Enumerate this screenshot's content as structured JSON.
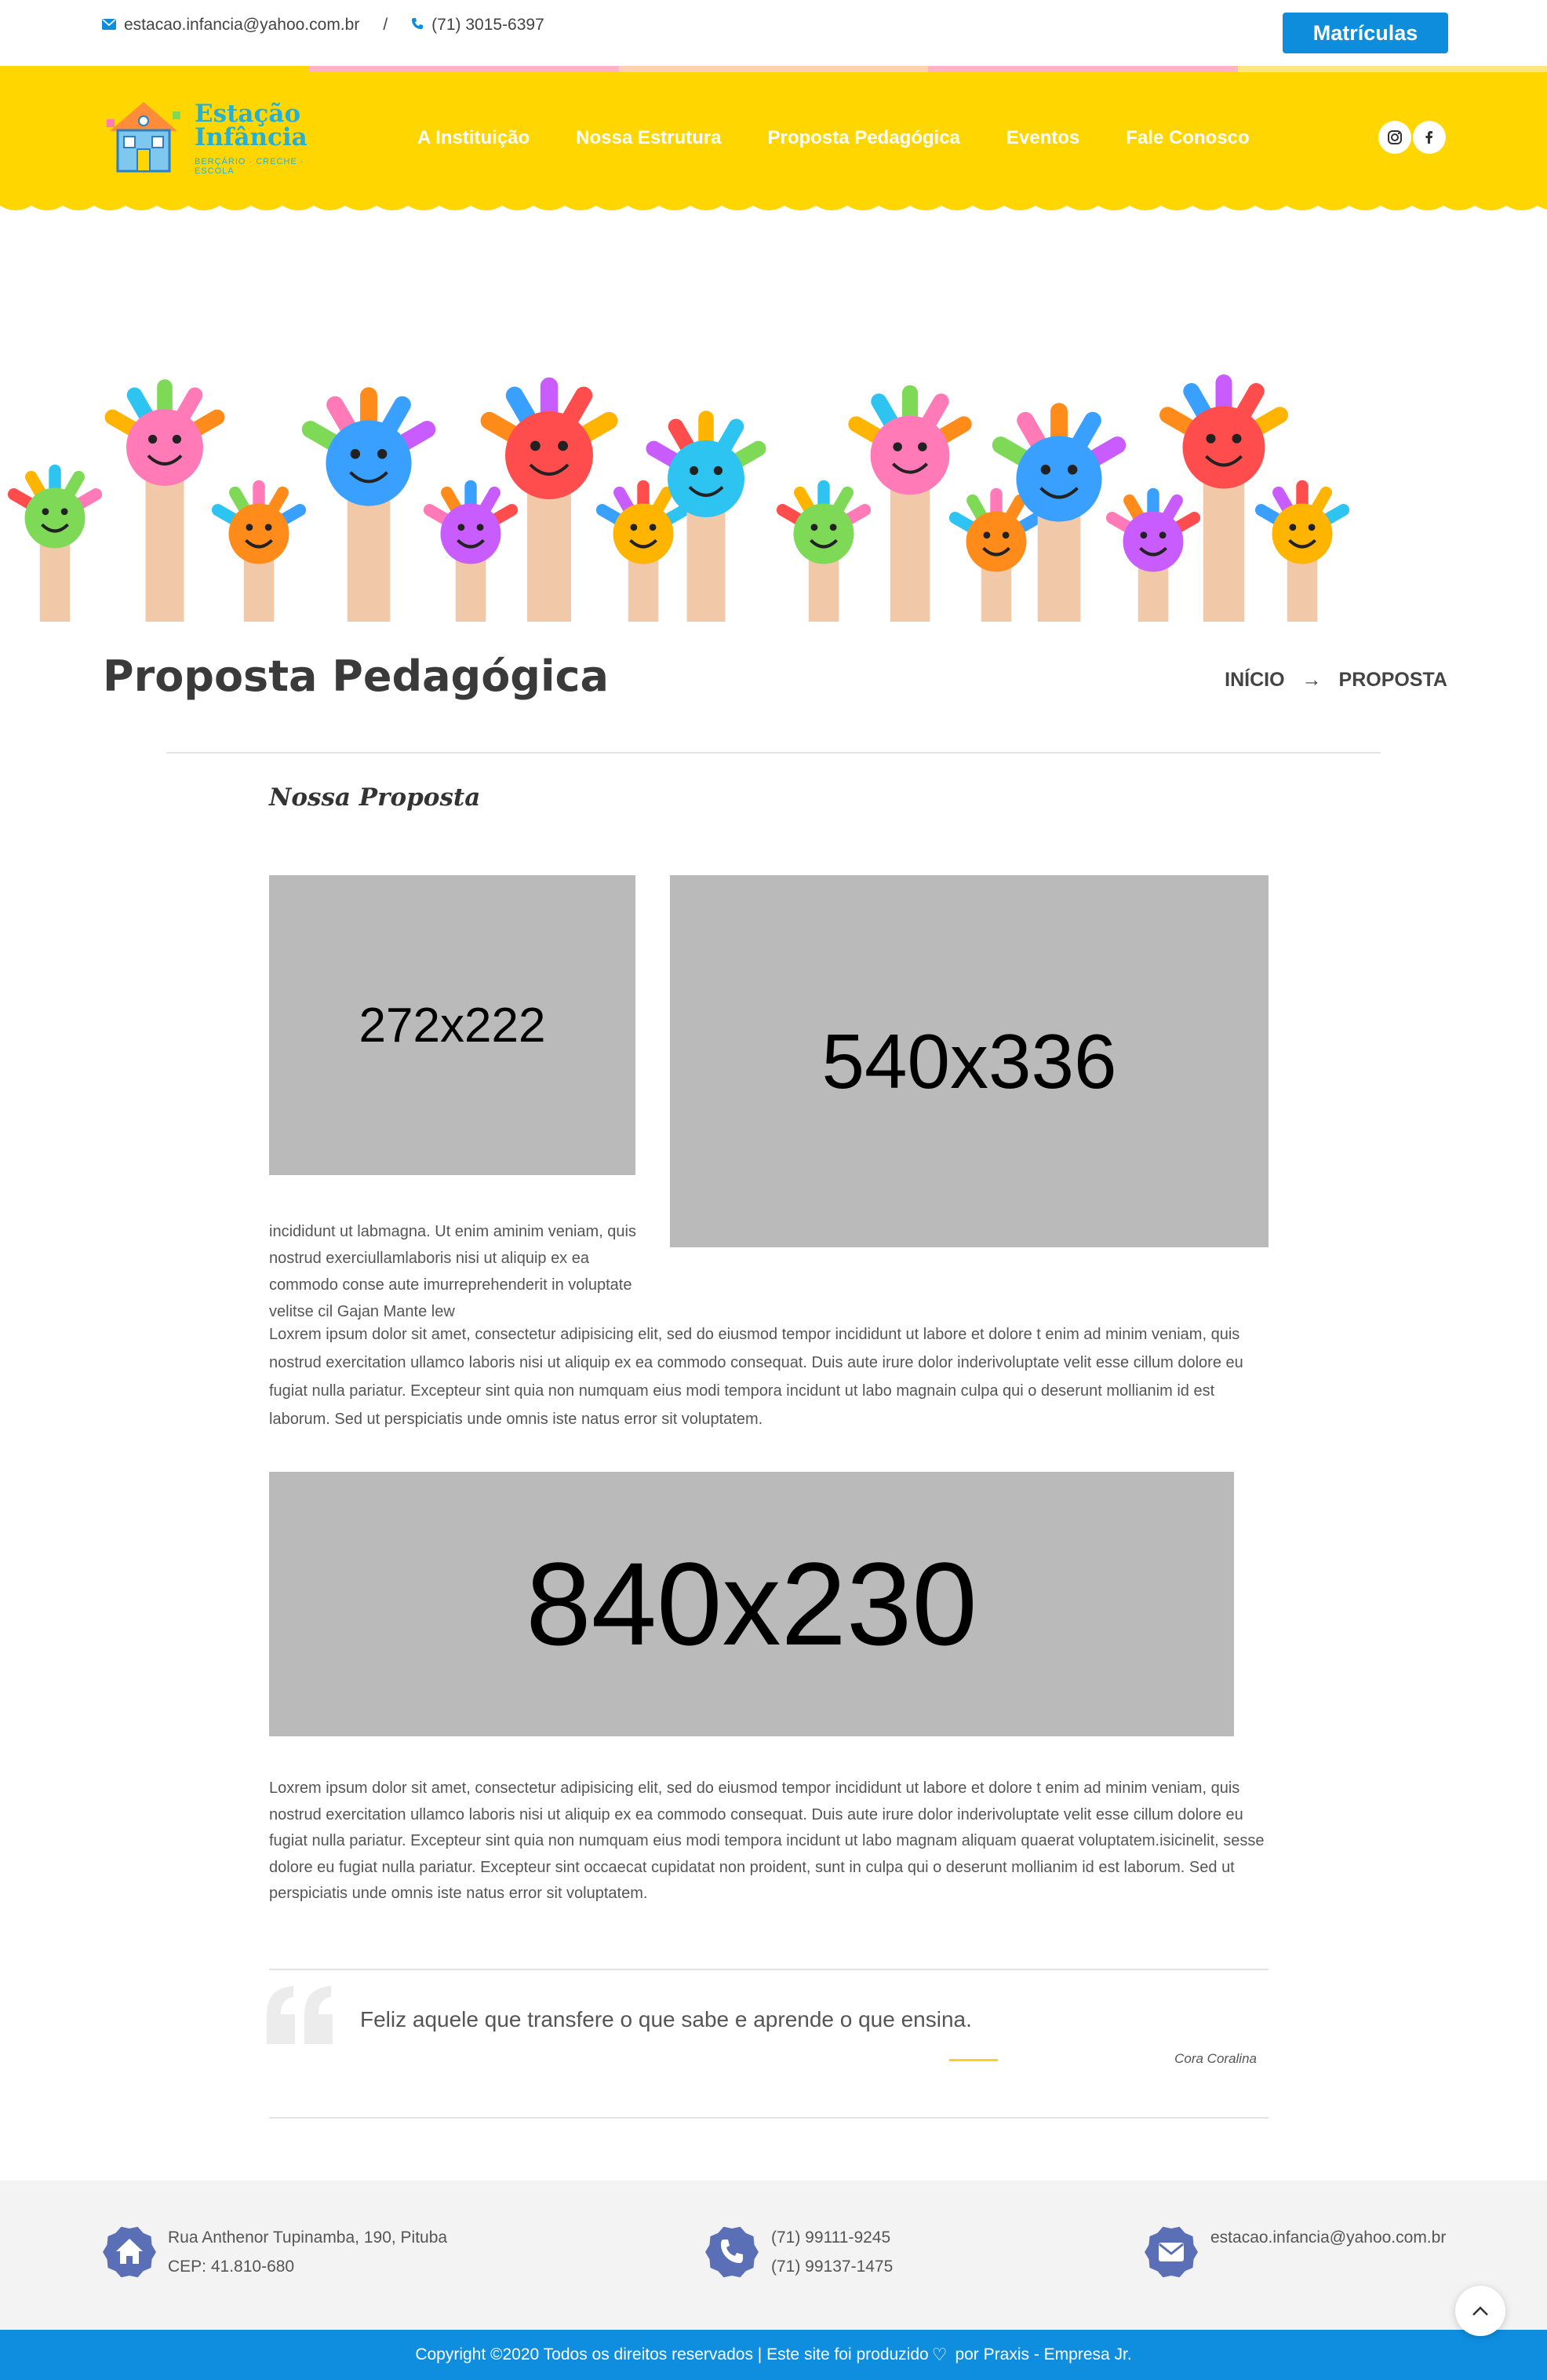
{
  "topbar": {
    "email": "estacao.infancia@yahoo.com.br",
    "separator": "/",
    "phone": "(71) 3015-6397",
    "cta_label": "Matrículas",
    "email_icon": "envelope-icon",
    "phone_icon": "phone-icon"
  },
  "brand": {
    "title_line1": "Estação",
    "title_line2": "Infância",
    "tagline": "BERÇÁRIO · CRECHE · ESCOLA"
  },
  "nav": {
    "items": [
      "A Instituição",
      "Nossa Estrutura",
      "Proposta Pedagógica",
      "Eventos",
      "Fale Conosco"
    ]
  },
  "social": {
    "instagram_icon": "instagram-icon",
    "facebook_icon": "facebook-icon"
  },
  "page": {
    "title": "Proposta Pedagógica",
    "breadcrumb_home": "INÍCIO",
    "breadcrumb_arrow": "→",
    "breadcrumb_current": "PROPOSTA"
  },
  "content": {
    "section_heading": "Nossa Proposta",
    "placeholder_1": "272x222",
    "placeholder_2": "540x336",
    "placeholder_3": "840x230",
    "small_paragraph": "incididunt ut labmagna. Ut enim aminim veniam, quis nostrud exerciullamlaboris nisi ut aliquip ex ea commodo conse aute imurreprehenderit in voluptate velitse cil Gajan Mante lew",
    "paragraph_1": "Loxrem ipsum dolor sit amet, consectetur adipisicing elit, sed do eiusmod tempor incididunt ut labore et dolore t enim ad minim veniam, quis nostrud exercitation ullamco laboris nisi ut aliquip ex ea commodo consequat. Duis aute irure dolor inderivoluptate velit esse cillum dolore eu fugiat nulla pariatur. Excepteur sint quia non numquam eius modi tempora incidunt ut labo magnain culpa qui o deserunt mollianim id est laborum. Sed ut perspiciatis unde omnis iste natus error sit voluptatem.",
    "paragraph_2": "Loxrem ipsum dolor sit amet, consectetur adipisicing elit, sed do eiusmod tempor incididunt ut labore et dolore t enim ad minim veniam, quis nostrud exercitation ullamco laboris nisi ut aliquip ex ea commodo consequat. Duis aute irure dolor inderivoluptate velit esse cillum dolore eu fugiat nulla pariatur. Excepteur sint quia non numquam eius modi tempora incidunt ut labo magnam aliquam quaerat voluptatem.isicinelit, sesse dolore eu fugiat nulla pariatur. Excepteur sint occaecat cupidatat non proident, sunt in culpa qui o deserunt mollianim id est laborum. Sed ut perspiciatis unde omnis iste natus error sit voluptatem."
  },
  "quote": {
    "text": "Feliz aquele que transfere o que sabe e aprende o que ensina.",
    "author": "Cora Coralina"
  },
  "footer": {
    "address_line1": "Rua Anthenor Tupinamba, 190, Pituba",
    "address_line2": "CEP: 41.810-680",
    "phone_1": "(71) 99111-9245",
    "phone_2": "(71) 99137-1475",
    "email": "estacao.infancia@yahoo.com.br",
    "copyright_part1": "Copyright ©2020 Todos os direitos reservados | Este site foi produzido",
    "copyright_part2": "por Praxis - Empresa Jr."
  },
  "colors": {
    "header_yellow": "#ffd600",
    "primary_blue": "#0d8ddb",
    "footer_icon": "#5b6fb6",
    "placeholder_gray": "#bababa"
  }
}
